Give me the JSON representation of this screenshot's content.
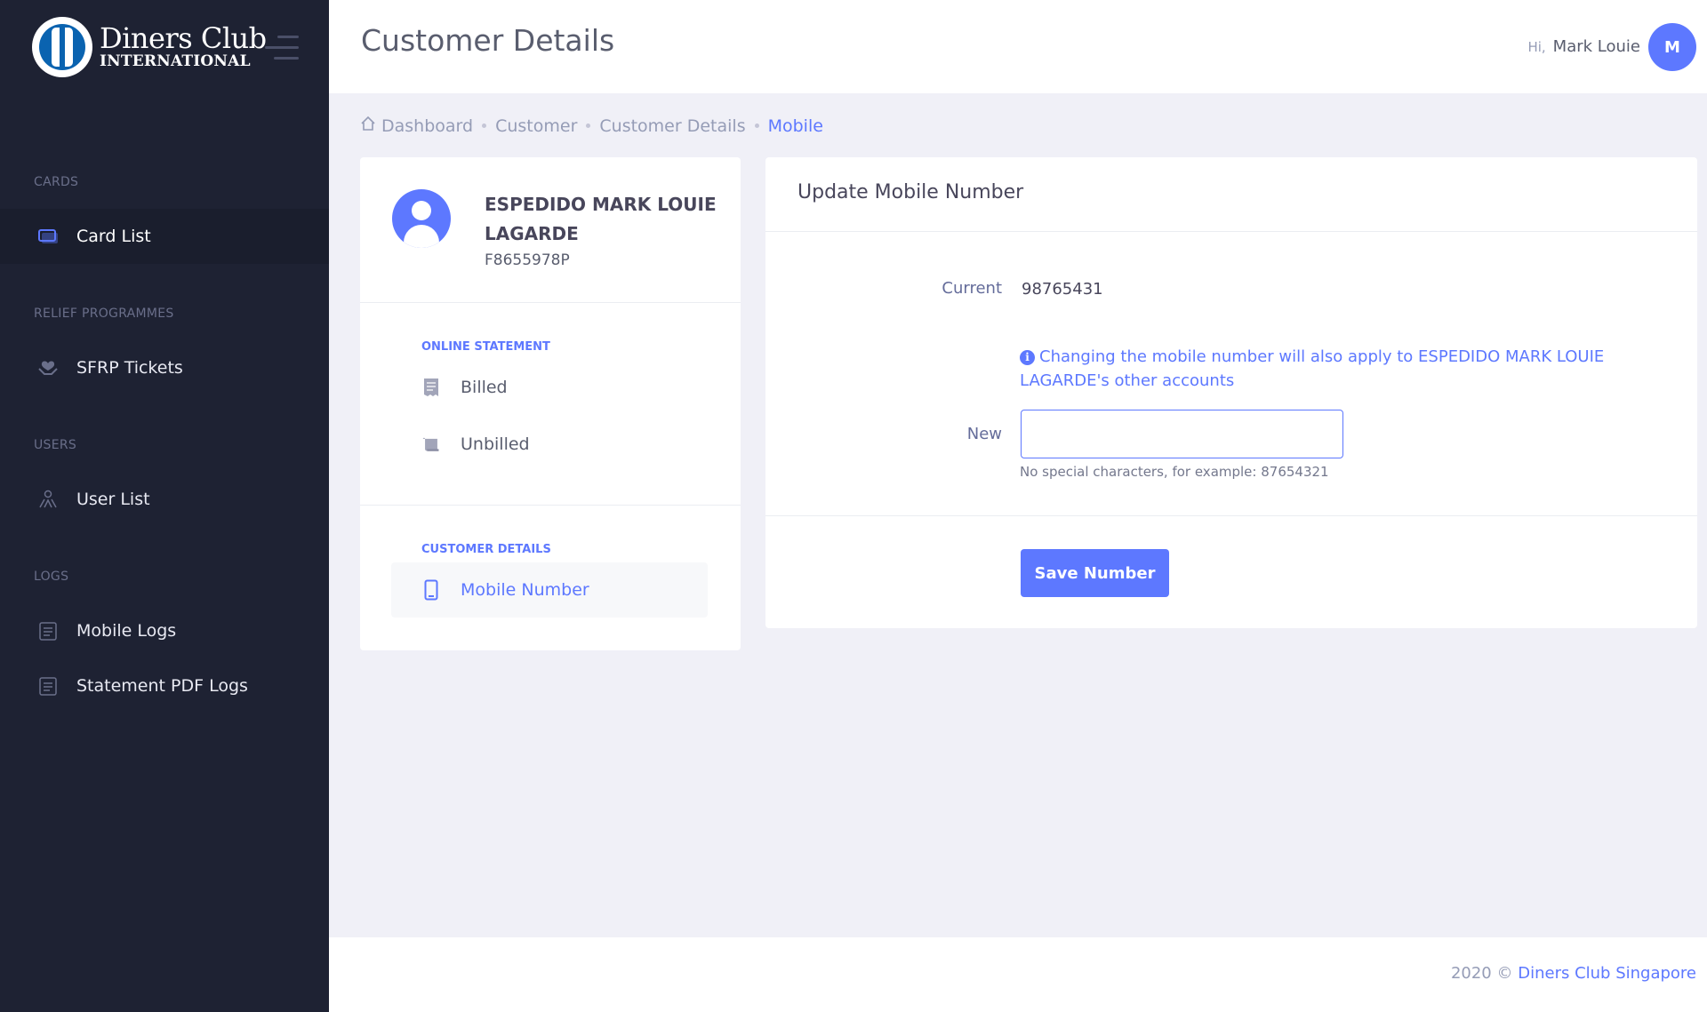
{
  "brand": {
    "logo_line1": "Diners Club",
    "logo_line2": "INTERNATIONAL"
  },
  "sidebar": {
    "sections": [
      {
        "title": "CARDS",
        "items": [
          {
            "label": "Card List",
            "icon": "card-icon",
            "active": true
          }
        ]
      },
      {
        "title": "RELIEF PROGRAMMES",
        "items": [
          {
            "label": "SFRP Tickets",
            "icon": "hands-heart-icon",
            "active": false
          }
        ]
      },
      {
        "title": "USERS",
        "items": [
          {
            "label": "User List",
            "icon": "users-icon",
            "active": false
          }
        ]
      },
      {
        "title": "LOGS",
        "items": [
          {
            "label": "Mobile Logs",
            "icon": "clipboard-icon",
            "active": false
          },
          {
            "label": "Statement PDF Logs",
            "icon": "clipboard-icon",
            "active": false
          }
        ]
      }
    ]
  },
  "header": {
    "title": "Customer Details",
    "greeting_prefix": "Hi,",
    "user_name": "Mark Louie",
    "avatar_initial": "M"
  },
  "breadcrumb": {
    "items": [
      "Dashboard",
      "Customer",
      "Customer Details"
    ],
    "current": "Mobile"
  },
  "profile": {
    "name": "ESPEDIDO MARK LOUIE LAGARDE",
    "id": "F8655978P",
    "sections": [
      {
        "title": "ONLINE STATEMENT",
        "items": [
          {
            "label": "Billed",
            "icon": "receipt-icon"
          },
          {
            "label": "Unbilled",
            "icon": "scroll-icon"
          }
        ]
      },
      {
        "title": "CUSTOMER DETAILS",
        "items": [
          {
            "label": "Mobile Number",
            "icon": "mobile-icon",
            "active": true
          }
        ]
      }
    ]
  },
  "form": {
    "title": "Update Mobile Number",
    "current_label": "Current",
    "current_value": "98765431",
    "info_text": "Changing the mobile number will also apply to ESPEDIDO MARK LOUIE LAGARDE's other accounts",
    "new_label": "New",
    "new_value": "",
    "hint": "No special characters, for example: 87654321",
    "save_label": "Save Number"
  },
  "footer": {
    "year": "2020 ©",
    "company": "Diners Club Singapore"
  },
  "colors": {
    "accent": "#5d78ff",
    "sidebar_bg": "#1e2233",
    "page_bg": "#f0f0f7"
  }
}
